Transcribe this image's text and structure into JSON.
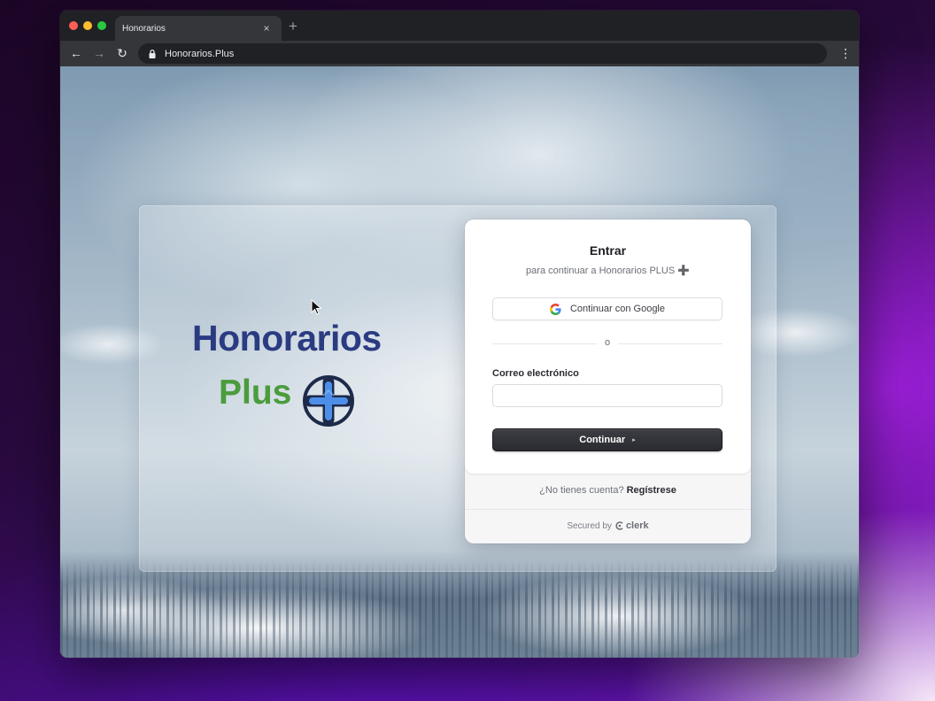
{
  "browser": {
    "tab_title": "Honorarios",
    "tab_close": "×",
    "new_tab": "+",
    "url": "Honorarios.Plus",
    "back": "←",
    "forward": "→",
    "reload": "↻",
    "menu": "⋮"
  },
  "brand": {
    "line1": "Honorarios",
    "line2": "Plus",
    "logo_icon": "plus-circle-icon",
    "colors": {
      "navy": "#2b3b82",
      "green": "#4a9c3d",
      "logo_blue": "#4d8fe8"
    }
  },
  "signin": {
    "title": "Entrar",
    "subtitle": "para continuar a Honorarios PLUS ➕",
    "google_button": "Continuar con Google",
    "divider": "o",
    "email_label": "Correo electrónico",
    "email_value": "",
    "email_placeholder": "",
    "continue_button": "Continuar",
    "continue_icon": "▸",
    "no_account": "¿No tienes cuenta?",
    "signup_link": "Regístrese",
    "secured_by": "Secured by",
    "provider": "clerk"
  }
}
